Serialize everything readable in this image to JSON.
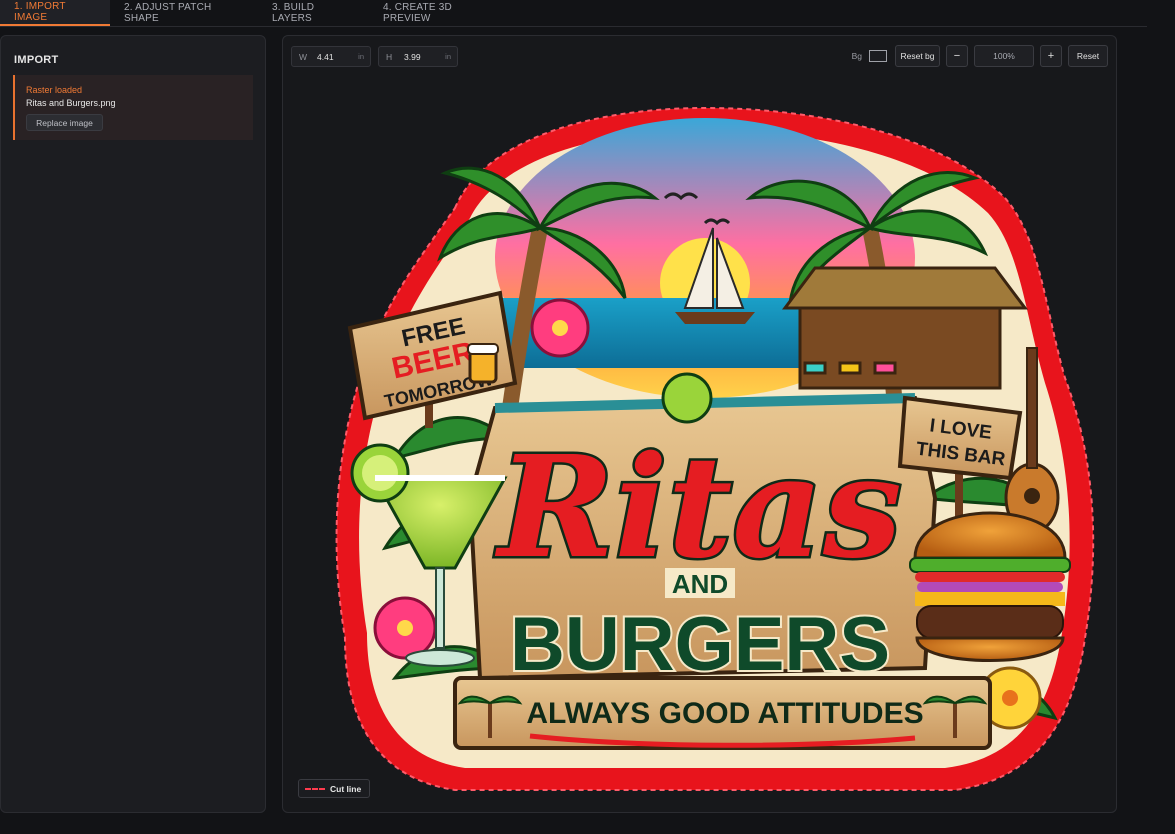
{
  "tabs": [
    {
      "label": "1. IMPORT IMAGE",
      "active": true
    },
    {
      "label": "2. ADJUST PATCH SHAPE",
      "active": false
    },
    {
      "label": "3. BUILD LAYERS",
      "active": false
    },
    {
      "label": "4. CREATE 3D PREVIEW",
      "active": false
    }
  ],
  "import_panel": {
    "heading": "IMPORT",
    "status_title": "Raster loaded",
    "file_name": "Ritas and Burgers.png",
    "replace_label": "Replace image"
  },
  "canvas": {
    "width": {
      "label": "W",
      "value": "4.41",
      "unit": "in"
    },
    "height": {
      "label": "H",
      "value": "3.99",
      "unit": "in"
    },
    "bg_label": "Bg",
    "reset_bg_label": "Reset bg",
    "zoom_out_label": "−",
    "zoom_value": "100%",
    "zoom_in_label": "+",
    "reset_label": "Reset",
    "cut_line_label": "Cut line",
    "cut_line_color": "#ff3b4e"
  },
  "artwork": {
    "sign_top": [
      "FREE",
      "BEER",
      "TOMORROW"
    ],
    "sign_right": [
      "I LOVE",
      "THIS BAR"
    ],
    "title_script": "Ritas",
    "title_and": "AND",
    "title_block": "BURGERS",
    "banner": "ALWAYS GOOD ATTITUDES"
  },
  "colors": {
    "accent": "#f07a35",
    "patch_border": "#e8141c",
    "title_red": "#e51d22",
    "title_green": "#0f4a2a",
    "wood": "#d9b07a"
  }
}
